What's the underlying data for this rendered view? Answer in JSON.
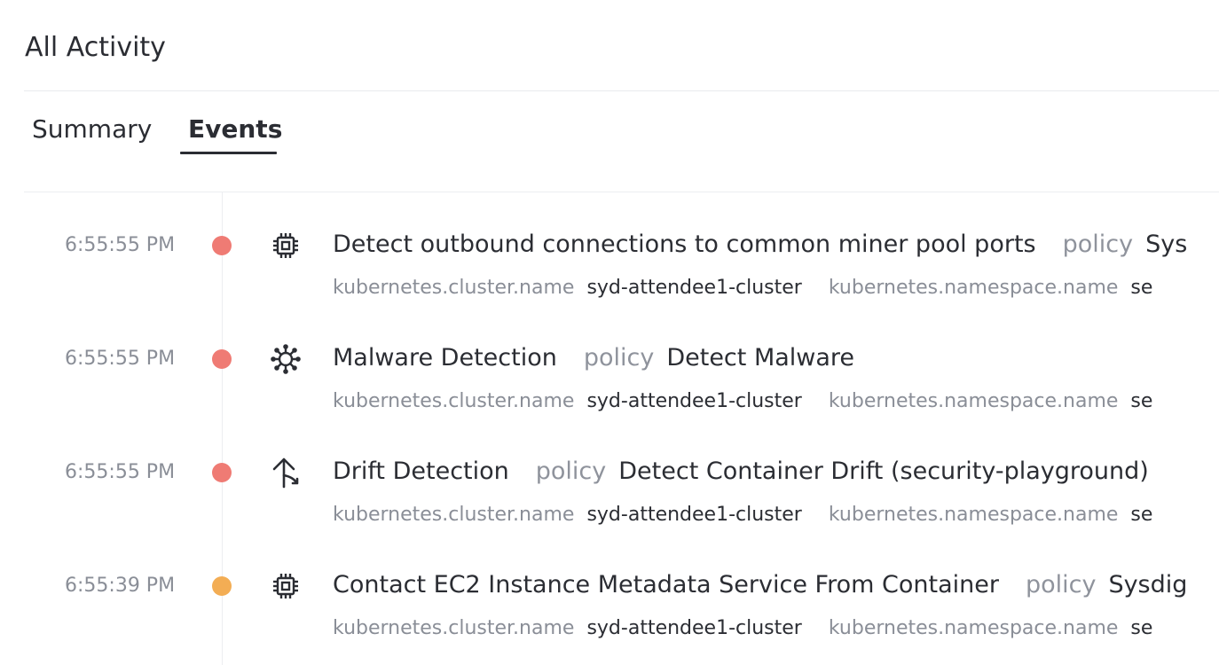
{
  "page": {
    "title": "All Activity"
  },
  "tabs": [
    {
      "label": "Summary",
      "active": false
    },
    {
      "label": "Events",
      "active": true
    }
  ],
  "colors": {
    "severity_high": "#ef7b74",
    "severity_medium": "#f3ad54",
    "accent": "#2b2d33"
  },
  "events": [
    {
      "time": "6:55:55 PM",
      "severity": "high",
      "icon": "cpu-chip-icon",
      "title": "Detect outbound connections to common miner pool ports",
      "policy_label": "policy",
      "policy_value": "Sys",
      "meta": [
        {
          "key": "kubernetes.cluster.name",
          "value": "syd-attendee1-cluster"
        },
        {
          "key": "kubernetes.namespace.name",
          "value": "se"
        }
      ]
    },
    {
      "time": "6:55:55 PM",
      "severity": "high",
      "icon": "malware-bug-icon",
      "title": "Malware Detection",
      "policy_label": "policy",
      "policy_value": "Detect Malware",
      "meta": [
        {
          "key": "kubernetes.cluster.name",
          "value": "syd-attendee1-cluster"
        },
        {
          "key": "kubernetes.namespace.name",
          "value": "se"
        }
      ]
    },
    {
      "time": "6:55:55 PM",
      "severity": "high",
      "icon": "drift-arrow-icon",
      "title": "Drift Detection",
      "policy_label": "policy",
      "policy_value": "Detect Container Drift (security-playground)",
      "meta": [
        {
          "key": "kubernetes.cluster.name",
          "value": "syd-attendee1-cluster"
        },
        {
          "key": "kubernetes.namespace.name",
          "value": "se"
        }
      ]
    },
    {
      "time": "6:55:39 PM",
      "severity": "medium",
      "icon": "cpu-chip-icon",
      "title": "Contact EC2 Instance Metadata Service From Container",
      "policy_label": "policy",
      "policy_value": "Sysdig",
      "meta": [
        {
          "key": "kubernetes.cluster.name",
          "value": "syd-attendee1-cluster"
        },
        {
          "key": "kubernetes.namespace.name",
          "value": "se"
        }
      ]
    }
  ]
}
